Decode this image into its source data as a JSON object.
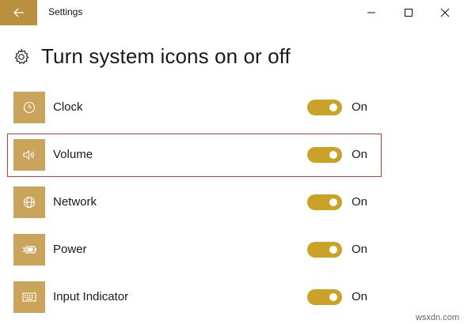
{
  "window": {
    "title": "Settings"
  },
  "page": {
    "title": "Turn system icons on or off"
  },
  "items": [
    {
      "label": "Clock",
      "icon": "clock-icon",
      "state": "On",
      "enabled": true
    },
    {
      "label": "Volume",
      "icon": "volume-icon",
      "state": "On",
      "enabled": true,
      "highlighted": true
    },
    {
      "label": "Network",
      "icon": "globe-icon",
      "state": "On",
      "enabled": true
    },
    {
      "label": "Power",
      "icon": "battery-plug-icon",
      "state": "On",
      "enabled": true
    },
    {
      "label": "Input Indicator",
      "icon": "keyboard-icon",
      "state": "On",
      "enabled": true
    }
  ],
  "watermark": "wsxdn.com",
  "colors": {
    "accent": "#b9913e",
    "tile": "#c9a45a",
    "toggle_on": "#c9a227",
    "highlight_border": "#d0393a"
  }
}
